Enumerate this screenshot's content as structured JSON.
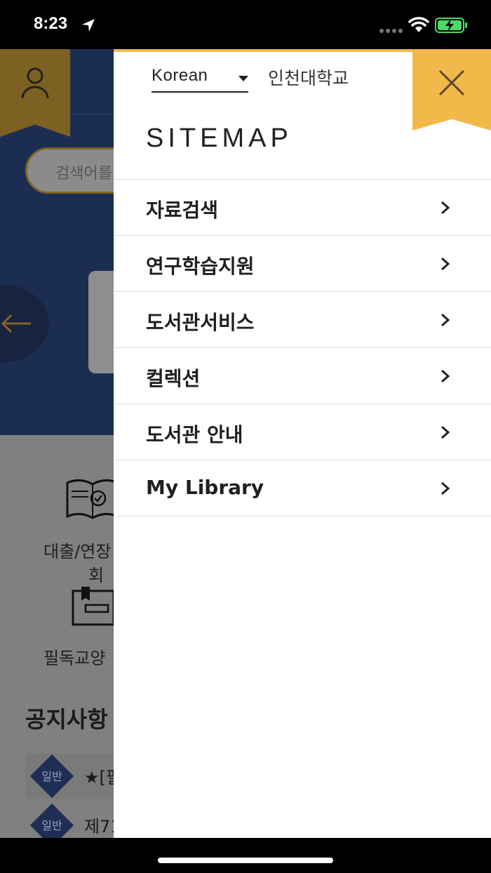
{
  "status_bar": {
    "time": "8:23"
  },
  "background": {
    "search_placeholder": "검색어를",
    "quick_links": [
      "대출/연장",
      "회",
      "필독교양"
    ],
    "notices_title": "공지사항",
    "notice_rows": [
      {
        "badge": "일반",
        "text": "★[필"
      },
      {
        "badge": "일반",
        "text": "제71"
      }
    ]
  },
  "drawer": {
    "language": "Korean",
    "university_link": "인천대학교",
    "title": "SITEMAP",
    "menu_items": [
      {
        "label": "자료검색"
      },
      {
        "label": "연구학습지원"
      },
      {
        "label": "도서관서비스"
      },
      {
        "label": "컬렉션"
      },
      {
        "label": "도서관 안내"
      },
      {
        "label": "My Library"
      }
    ]
  },
  "colors": {
    "accent": "#f3b84a",
    "header_blue": "#1c2d52",
    "text_dark": "#1f1f1f"
  }
}
